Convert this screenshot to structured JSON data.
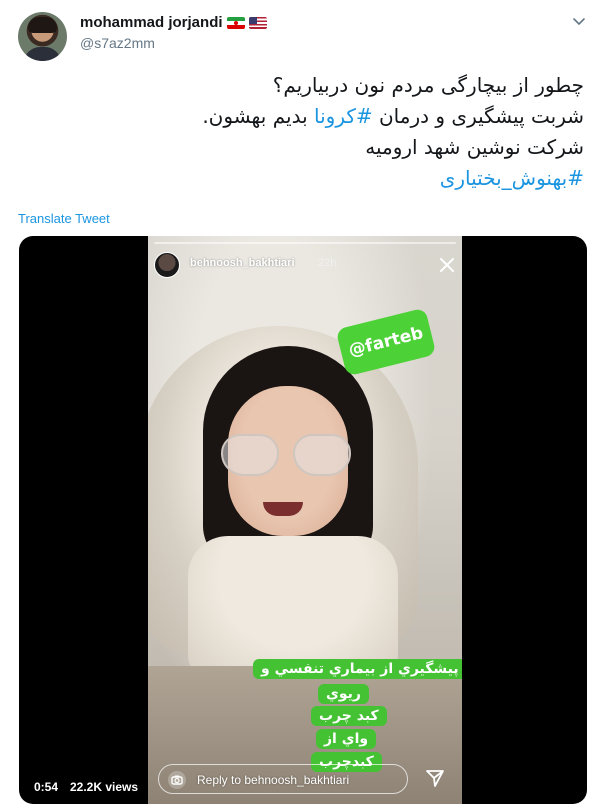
{
  "author": {
    "display_name": "mohammad jorjandi",
    "handle": "@s7az2mm",
    "flags": [
      "iran-flag-icon",
      "us-flag-icon"
    ]
  },
  "tweet": {
    "lines": [
      {
        "text": "چطور از بیچارگی مردم نون دربیاریم؟",
        "hashtag": ""
      },
      {
        "before": "شربت پیشگیری و درمان ",
        "hashtag": "#کرونا",
        "after": " بدیم بهشون."
      },
      {
        "text": "شرکت نوشین شهد ارومیه",
        "hashtag": ""
      },
      {
        "text": "",
        "hashtag": "#بهنوش_بختیاری"
      }
    ],
    "translate_label": "Translate Tweet"
  },
  "media": {
    "story_username": "behnoosh_bakhtiari",
    "story_time": "22h",
    "sticker_mention": "@farteb",
    "sticker_lines": [
      "پيشگيري از بيماري تنفسي و",
      "ريوي",
      "كبد چرب",
      "واي از",
      "كبدچرب"
    ],
    "reply_placeholder": "Reply to behnoosh_bakhtiari",
    "duration": "0:54",
    "views": "22.2K views"
  },
  "colors": {
    "link": "#1b95e0",
    "text": "#14171a",
    "muted": "#657786",
    "sticker_green": "#45c234"
  }
}
